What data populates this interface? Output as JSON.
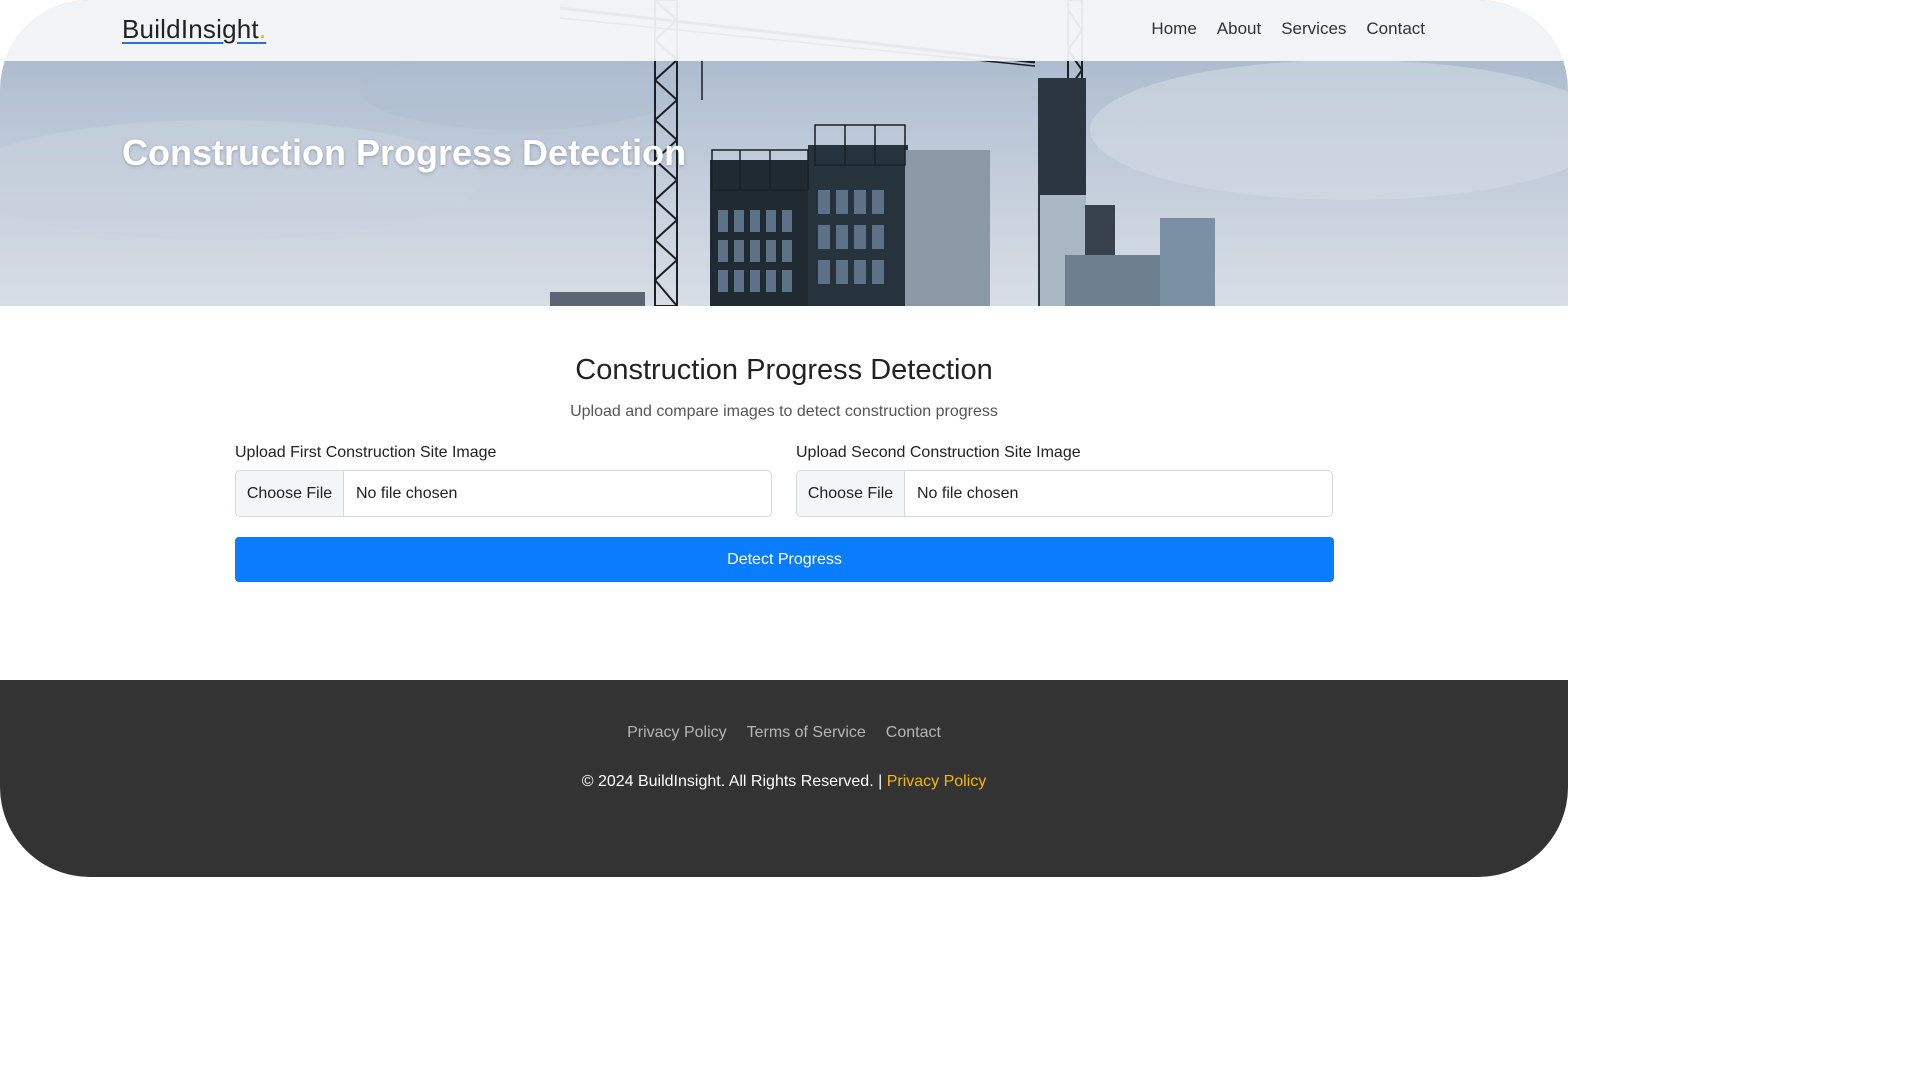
{
  "navbar": {
    "brand": "BuildInsight",
    "brand_dot": ".",
    "links": [
      "Home",
      "About",
      "Services",
      "Contact"
    ]
  },
  "hero": {
    "title": "Construction Progress Detection"
  },
  "main": {
    "title": "Construction Progress Detection",
    "subtitle": "Upload and compare images to detect construction progress",
    "upload_first": {
      "label": "Upload First Construction Site Image",
      "button": "Choose File",
      "status": "No file chosen"
    },
    "upload_second": {
      "label": "Upload Second Construction Site Image",
      "button": "Choose File",
      "status": "No file chosen"
    },
    "detect_button": "Detect Progress"
  },
  "footer": {
    "links": [
      "Privacy Policy",
      "Terms of Service",
      "Contact"
    ],
    "copyright": "© 2024 BuildInsight. All Rights Reserved. |",
    "copyright_link": "Privacy Policy"
  },
  "colors": {
    "primary": "#0a7cff",
    "brand_accent": "#f0b400",
    "footer_bg": "#333333",
    "footer_link_accent": "#f5b800"
  }
}
